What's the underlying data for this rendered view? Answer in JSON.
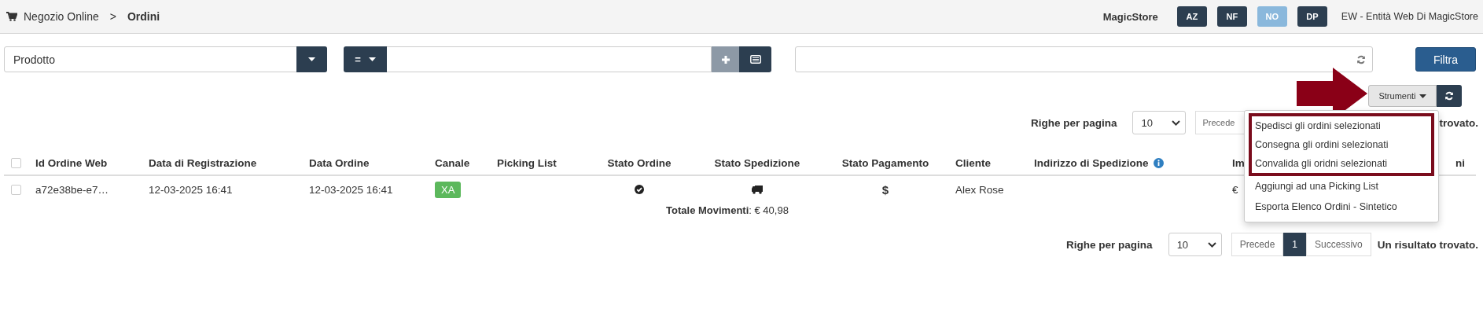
{
  "breadcrumb": {
    "items": [
      {
        "label": "Negozio Online",
        "current": false
      },
      {
        "label": "Ordini",
        "current": true
      }
    ],
    "separator": ">"
  },
  "header": {
    "store": "MagicStore",
    "toggles": [
      {
        "label": "AZ",
        "selected": false
      },
      {
        "label": "NF",
        "selected": false
      },
      {
        "label": "NO",
        "selected": true
      },
      {
        "label": "DP",
        "selected": false
      }
    ],
    "entity": "EW - Entità Web Di MagicStore"
  },
  "filters": {
    "field": {
      "value": "Prodotto"
    },
    "operator": {
      "label": "="
    },
    "filter_button": "Filtra"
  },
  "toolbar": {
    "tools_button": "Strumenti",
    "menu": {
      "items": [
        {
          "label": "Spedisci gli ordini selezionati",
          "highlighted": true
        },
        {
          "label": "Consegna gli ordini selezionati",
          "highlighted": true
        },
        {
          "label": "Convalida gli oridni selezionati",
          "highlighted": true
        },
        {
          "label": "Aggiungi ad una Picking List",
          "highlighted": false
        },
        {
          "label": "Esporta Elenco Ordini - Sintetico",
          "highlighted": false
        }
      ]
    }
  },
  "pagination_top": {
    "label": "Righe per pagina",
    "page_size": "10",
    "prev": "Precede",
    "status": "trovato."
  },
  "table": {
    "header_checked": false,
    "columns": [
      {
        "label": "Id Ordine Web"
      },
      {
        "label": "Data di Registrazione"
      },
      {
        "label": "Data Ordine"
      },
      {
        "label": "Canale"
      },
      {
        "label": "Picking List"
      },
      {
        "label": "Stato Ordine"
      },
      {
        "label": "Stato Spedizione"
      },
      {
        "label": "Stato Pagamento"
      },
      {
        "label": "Cliente"
      },
      {
        "label": "Indirizzo di Spedizione",
        "info": true
      },
      {
        "label": "Im"
      },
      {
        "label": "ni"
      }
    ],
    "rows": [
      {
        "checked": false,
        "cells": [
          {
            "kind": "text",
            "text": "a72e38be-e7…"
          },
          {
            "kind": "text",
            "text": "12-03-2025 16:41"
          },
          {
            "kind": "text",
            "text": "12-03-2025 16:41"
          },
          {
            "kind": "badge",
            "text": "XA",
            "color": "#5cb85c"
          },
          {
            "kind": "empty"
          },
          {
            "kind": "status"
          },
          {
            "kind": "status"
          },
          {
            "kind": "symbol",
            "text": "$"
          },
          {
            "kind": "text",
            "text": "Alex Rose"
          },
          {
            "kind": "empty"
          },
          {
            "kind": "text",
            "text": "€"
          },
          {
            "kind": "empty"
          }
        ]
      }
    ],
    "total": "**Totale Movimenti**: € 40,98"
  },
  "pagination_bottom": {
    "label": "Righe per pagina",
    "page_size": "10",
    "prev": "Precede",
    "pages": [
      {
        "label": "1",
        "selected": true
      }
    ],
    "next": "Successivo",
    "status": "Un risultato trovato."
  }
}
